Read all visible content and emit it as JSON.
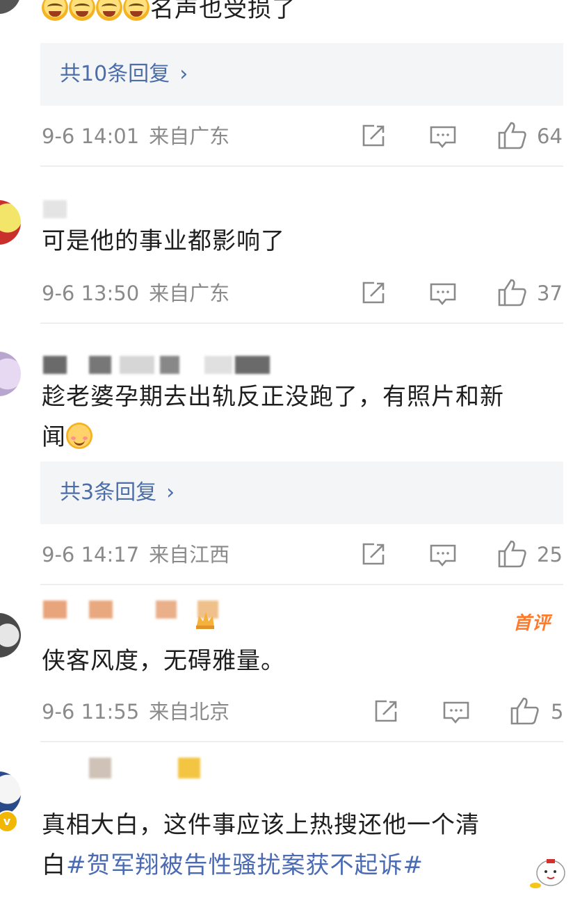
{
  "comments": [
    {
      "text_tail": "名声也受损了",
      "emoji_count": 4,
      "replies": "共10条回复",
      "time": "9-6 14:01",
      "location": "来自广东",
      "likes": "64"
    },
    {
      "text": "可是他的事业都影响了",
      "time": "9-6 13:50",
      "location": "来自广东",
      "likes": "37"
    },
    {
      "text_line1": "趁老婆孕期去出轨反正没跑了，有照片和新",
      "text_line2": "闻",
      "replies": "共3条回复",
      "time": "9-6 14:17",
      "location": "来自江西",
      "likes": "25"
    },
    {
      "badge": "首评",
      "text": "侠客风度，无碍雅量。",
      "time": "9-6 11:55",
      "location": "来自北京",
      "likes": "5"
    },
    {
      "text_line1": "真相大白，这件事应该上热搜还他一个清",
      "text_line2_plain": "白",
      "hashtag": "#贺军翔被告性骚扰案获不起诉#",
      "verified_badge": "v"
    }
  ],
  "icons": {
    "share": "share-icon",
    "comment": "comment-icon",
    "like": "thumbs-up-icon",
    "chevron": "chevron-right-icon"
  },
  "colors": {
    "link": "#4b6ea9",
    "hashtag": "#4a6bb3",
    "meta": "#8a8a8a",
    "first_badge": "#ff7a2a",
    "reply_bg": "#f4f5f7"
  }
}
